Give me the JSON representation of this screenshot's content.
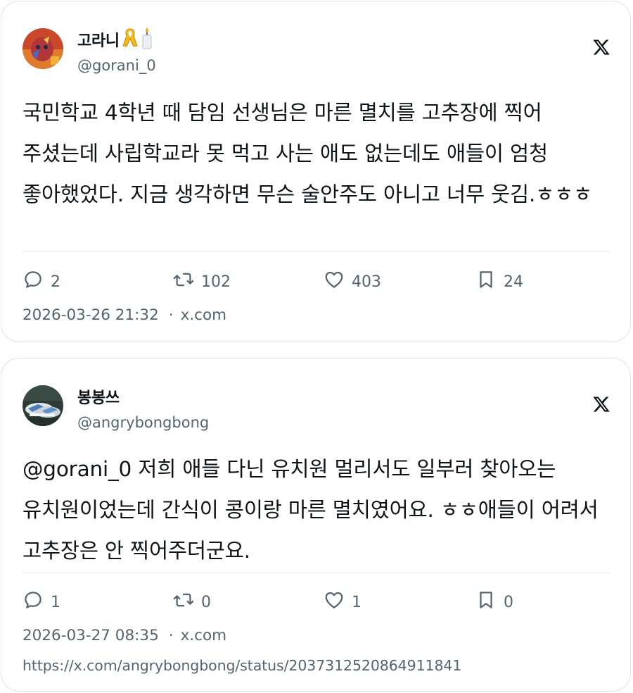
{
  "tweets": [
    {
      "display_name": "고라니",
      "name_emojis": [
        "ribbon-icon",
        "candle-icon"
      ],
      "handle": "@gorani_0",
      "text": "국민학교 4학년 때 담임 선생님은 마른 멸치를 고추장에 찍어 주셨는데 사립학교라 못 먹고 사는 애도 없는데도 애들이 엄청 좋아했었다. 지금 생각하면 무슨 술안주도 아니고 너무 웃김.ㅎㅎㅎ",
      "replies": "2",
      "reposts": "102",
      "likes": "403",
      "bookmarks": "24",
      "timestamp": "2026-03-26 21:32",
      "source": "x.com"
    },
    {
      "display_name": "봉봉쓰",
      "handle": "@angrybongbong",
      "text": "@gorani_0 저희 애들 다닌 유치원 멀리서도 일부러 찾아오는 유치원이었는데 간식이 콩이랑 마른 멸치였어요. ㅎㅎ애들이 어려서 고추장은 안 찍어주더군요.",
      "replies": "1",
      "reposts": "0",
      "likes": "1",
      "bookmarks": "0",
      "timestamp": "2026-03-27 08:35",
      "source": "x.com",
      "url": "https://x.com/angrybongbong/status/2037312520864911841"
    }
  ],
  "colors": {
    "text": "#0f1419",
    "secondary": "#536471",
    "border": "#dfe3e7"
  }
}
